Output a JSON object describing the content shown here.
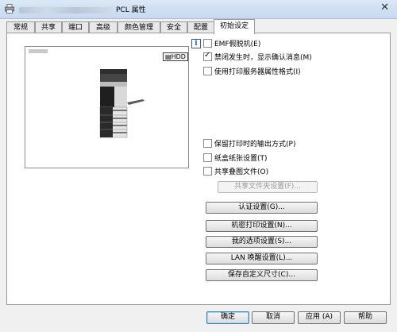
{
  "window": {
    "title_suffix": "PCL 属性",
    "close_symbol": "✕"
  },
  "tabs": [
    "常规",
    "共享",
    "端口",
    "高级",
    "颜色管理",
    "安全",
    "配置",
    "初始设定"
  ],
  "preview": {
    "storage_label": "HDD"
  },
  "info_symbol": "i",
  "options_top": [
    {
      "label": "EMF假脱机(E)",
      "checked": false
    },
    {
      "label": "禁闭发生时，显示确认消息(M)",
      "checked": true
    },
    {
      "label": "使用打印服务器属性格式(I)",
      "checked": false
    }
  ],
  "options_bottom": [
    {
      "label": "保留打印时的输出方式(P)",
      "checked": false
    },
    {
      "label": "纸盒纸张设置(T)",
      "checked": false
    },
    {
      "label": "共享叠图文件(O)",
      "checked": false
    }
  ],
  "check_mark": "✓",
  "shared_folder_button": "共享文件夹设置(F)...",
  "setting_buttons": [
    "认证设置(G)...",
    "机密打印设置(N)...",
    "我的选项设置(S)...",
    "LAN 唤醒设置(L)...",
    "保存自定义尺寸(C)..."
  ],
  "footer_buttons": {
    "ok": "确定",
    "cancel": "取消",
    "apply": "应用 (A)",
    "help": "帮助"
  }
}
